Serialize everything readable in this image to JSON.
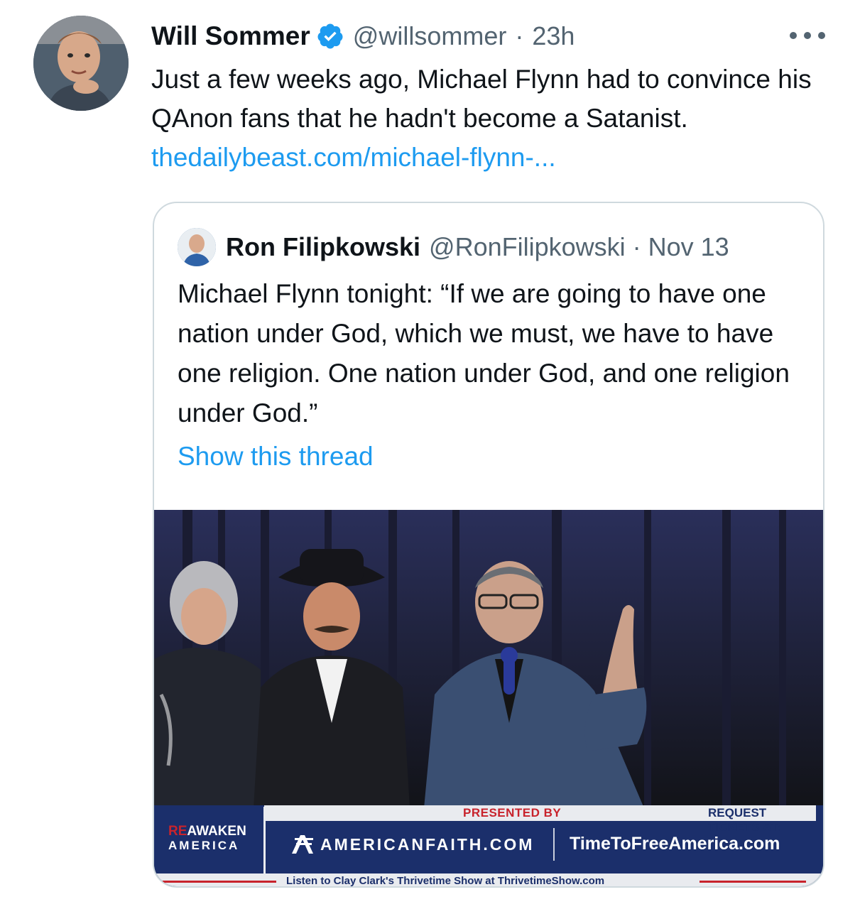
{
  "tweet": {
    "author_name": "Will Sommer",
    "author_handle": "@willsommer",
    "separator": "·",
    "time": "23h",
    "text": "Just a few weeks ago, Michael Flynn had to convince his QAnon fans that he hadn't become a Satanist. ",
    "link_text": "thedailybeast.com/michael-flynn-...",
    "verified_icon": "verified-badge-icon",
    "more_icon": "more-options-icon",
    "colors": {
      "link": "#1d9bf0",
      "secondary_text": "#536471",
      "primary_text": "#0f1419"
    }
  },
  "quote": {
    "author_name": "Ron Filipkowski",
    "author_handle": "@RonFilipkowski",
    "separator": "·",
    "time": "Nov 13",
    "text": "Michael Flynn tonight: “If we are going to have one nation under God, which we must, we have to have one religion. One nation under God, and one religion under God.”",
    "show_thread": "Show this thread",
    "media": {
      "banner": {
        "presented_by": "PRESENTED BY",
        "request_tickets": "REQUEST TICKETS AT:",
        "awaken_prefix": "RE",
        "awaken_word": "AWAKEN",
        "awaken_america": "AMERICA",
        "american_faith": "AMERICANFAITH.COM",
        "ticket_site": "TimeToFreeAmerica.com",
        "listen_line": "Listen to Clay Clark's Thrivetime Show at ThrivetimeShow.com"
      }
    }
  }
}
